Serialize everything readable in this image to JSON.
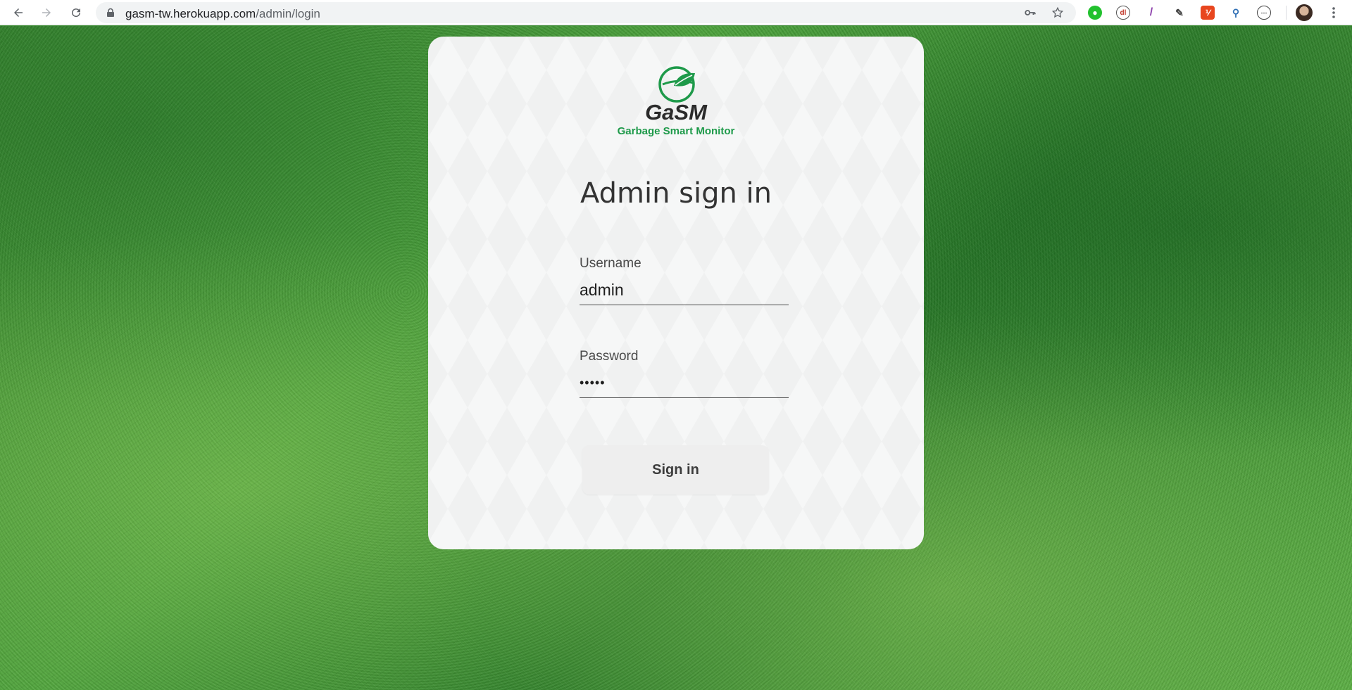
{
  "browser": {
    "url_host": "gasm-tw.herokuapp.com",
    "url_path": "/admin/login",
    "nav_icons": [
      "back-arrow-icon",
      "forward-arrow-icon",
      "reload-icon"
    ],
    "omnibox_icons": [
      "lock-icon",
      "key-icon",
      "star-icon"
    ],
    "extensions": [
      "green-extension-icon",
      "chart-extension-icon",
      "pen-extension-icon",
      "eyedropper-extension-icon",
      "red-extension-icon",
      "search-extension-icon",
      "code-extension-icon"
    ]
  },
  "logo": {
    "name": "GaSM",
    "tagline": "Garbage Smart Monitor",
    "brand_color": "#1e9a4a"
  },
  "login": {
    "title": "Admin sign in",
    "username_label": "Username",
    "username_value": "admin",
    "password_label": "Password",
    "password_value": "•••••",
    "submit_label": "Sign in"
  }
}
